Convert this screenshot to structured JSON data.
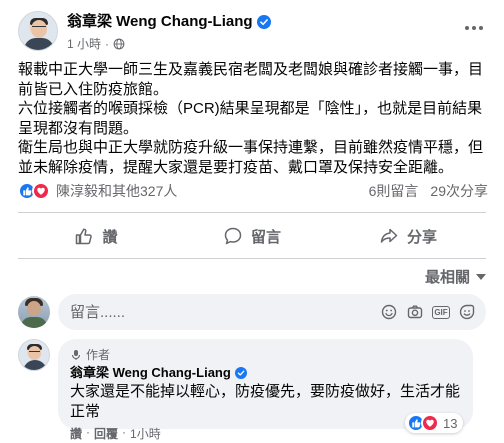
{
  "post": {
    "author": "翁章梁 Weng Chang-Liang",
    "time": "1 小時",
    "paragraphs": [
      "報載中正大學一師三生及嘉義民宿老闆及老闆娘與確診者接觸一事，目前皆已入住防疫旅館。",
      "六位接觸者的喉頭採檢（PCR)結果呈現都是「陰性」，也就是目前結果呈現都沒有問題。",
      "衛生局也與中正大學就防疫升級一事保持連繫，目前雖然疫情平穩，但並未解除疫情，提醒大家還是要打疫苗、戴口罩及保持安全距離。"
    ]
  },
  "stats": {
    "reactors": "陳淳毅和其他327人",
    "comments": "6則留言",
    "shares": "29次分享"
  },
  "actions": {
    "like": "讚",
    "comment": "留言",
    "share": "分享"
  },
  "sort_label": "最相關",
  "composer": {
    "placeholder": "留言......"
  },
  "comment": {
    "badge": "作者",
    "author": "翁章梁 Weng Chang-Liang",
    "text": "大家還是不能掉以輕心，防疫優先，要防疫做好，生活才能正常",
    "like": "讚",
    "reply": "回覆",
    "time": "1小時",
    "reaction_count": "13"
  },
  "colors": {
    "accent": "#1877f2",
    "love": "#f0284a",
    "muted": "#65676b"
  }
}
